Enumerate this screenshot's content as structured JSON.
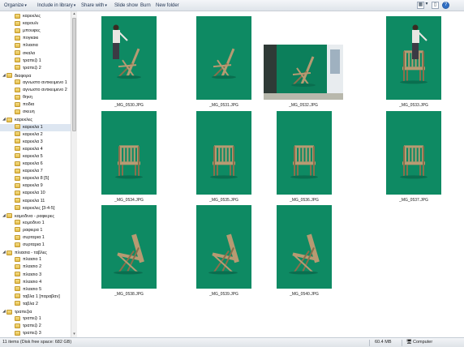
{
  "toolbar": {
    "organize": "Organize",
    "include_in_library": "Include in library",
    "share_with": "Share with",
    "slide_show": "Slide show",
    "burn": "Burn",
    "new_folder": "New folder"
  },
  "tree": [
    {
      "label": "καρεκλες",
      "level": 1,
      "expanded": false
    },
    {
      "label": "καρουλι",
      "level": 1
    },
    {
      "label": "μπουφες",
      "level": 1
    },
    {
      "label": "πογκακι",
      "level": 1
    },
    {
      "label": "πλιασια",
      "level": 1
    },
    {
      "label": "σκαλα",
      "level": 1
    },
    {
      "label": "τραπεζι 1",
      "level": 1
    },
    {
      "label": "τραπεζι 2",
      "level": 1
    },
    {
      "label": "διαφορα",
      "level": 0,
      "expanded": true
    },
    {
      "label": "αγνωστο αντικειμενο 1",
      "level": 1
    },
    {
      "label": "αγνωστο αντικειμενο 2",
      "level": 1
    },
    {
      "label": "θηκη",
      "level": 1
    },
    {
      "label": "ποδια",
      "level": 1
    },
    {
      "label": "σκευη",
      "level": 1
    },
    {
      "label": "καρεκλες",
      "level": 0,
      "expanded": true
    },
    {
      "label": "καρεκλα 1",
      "level": 1,
      "selected": true
    },
    {
      "label": "καρεκλα 2",
      "level": 1
    },
    {
      "label": "καρεκλα 3",
      "level": 1
    },
    {
      "label": "καρεκλα 4",
      "level": 1
    },
    {
      "label": "καρεκλα 5",
      "level": 1
    },
    {
      "label": "καρεκλα 6",
      "level": 1
    },
    {
      "label": "καρεκλα 7",
      "level": 1
    },
    {
      "label": "καρεκλα 8 [5]",
      "level": 1
    },
    {
      "label": "καρεκλα 9",
      "level": 1
    },
    {
      "label": "καρεκλα 10",
      "level": 1
    },
    {
      "label": "καρεκλα 11",
      "level": 1
    },
    {
      "label": "καρεκλες [3-4-5]",
      "level": 1
    },
    {
      "label": "καμοδινα - ραφιερες",
      "level": 0,
      "expanded": true
    },
    {
      "label": "κομοδινο 1",
      "level": 1
    },
    {
      "label": "ραφιερα 1",
      "level": 1
    },
    {
      "label": "συρταρια 1",
      "level": 1
    },
    {
      "label": "συρταρια 1",
      "level": 1
    },
    {
      "label": "πλιασια - ταβλες",
      "level": 0,
      "expanded": true
    },
    {
      "label": "πλαισιο 1",
      "level": 1
    },
    {
      "label": "πλαισιο 2",
      "level": 1
    },
    {
      "label": "πλαισιο 3",
      "level": 1
    },
    {
      "label": "πλαισιο 4",
      "level": 1
    },
    {
      "label": "πλαισιο 5",
      "level": 1
    },
    {
      "label": "ταβλα 1 [παραβαν]",
      "level": 1
    },
    {
      "label": "ταβλα 2",
      "level": 1
    },
    {
      "label": "τραπεζια",
      "level": 0,
      "expanded": true
    },
    {
      "label": "τραπεζι 1",
      "level": 1
    },
    {
      "label": "τραπεζι 2",
      "level": 1
    },
    {
      "label": "τραπεζι 3",
      "level": 1
    }
  ],
  "files": [
    {
      "name": "_MG_0530.JPG",
      "orientation": "portrait",
      "person": true
    },
    {
      "name": "_MG_0531.JPG",
      "orientation": "portrait"
    },
    {
      "name": "_MG_0532.JPG",
      "orientation": "landscape"
    },
    {
      "name": "_MG_0533.JPG",
      "orientation": "portrait",
      "person": true
    },
    {
      "name": "_MG_0534.JPG",
      "orientation": "portrait"
    },
    {
      "name": "_MG_0535.JPG",
      "orientation": "portrait"
    },
    {
      "name": "_MG_0536.JPG",
      "orientation": "portrait"
    },
    {
      "name": "_MG_0537.JPG",
      "orientation": "portrait"
    },
    {
      "name": "_MG_0538.JPG",
      "orientation": "portrait"
    },
    {
      "name": "_MG_0539.JPG",
      "orientation": "portrait"
    },
    {
      "name": "_MG_0540.JPG",
      "orientation": "portrait"
    }
  ],
  "status": {
    "items": "11 items (Disk free space: 682 GB)",
    "size": "60.4 MB",
    "location": "Computer"
  },
  "colors": {
    "backdrop": "#0e8a63",
    "wood": "#b79a72",
    "selection": "#dde6f1"
  }
}
